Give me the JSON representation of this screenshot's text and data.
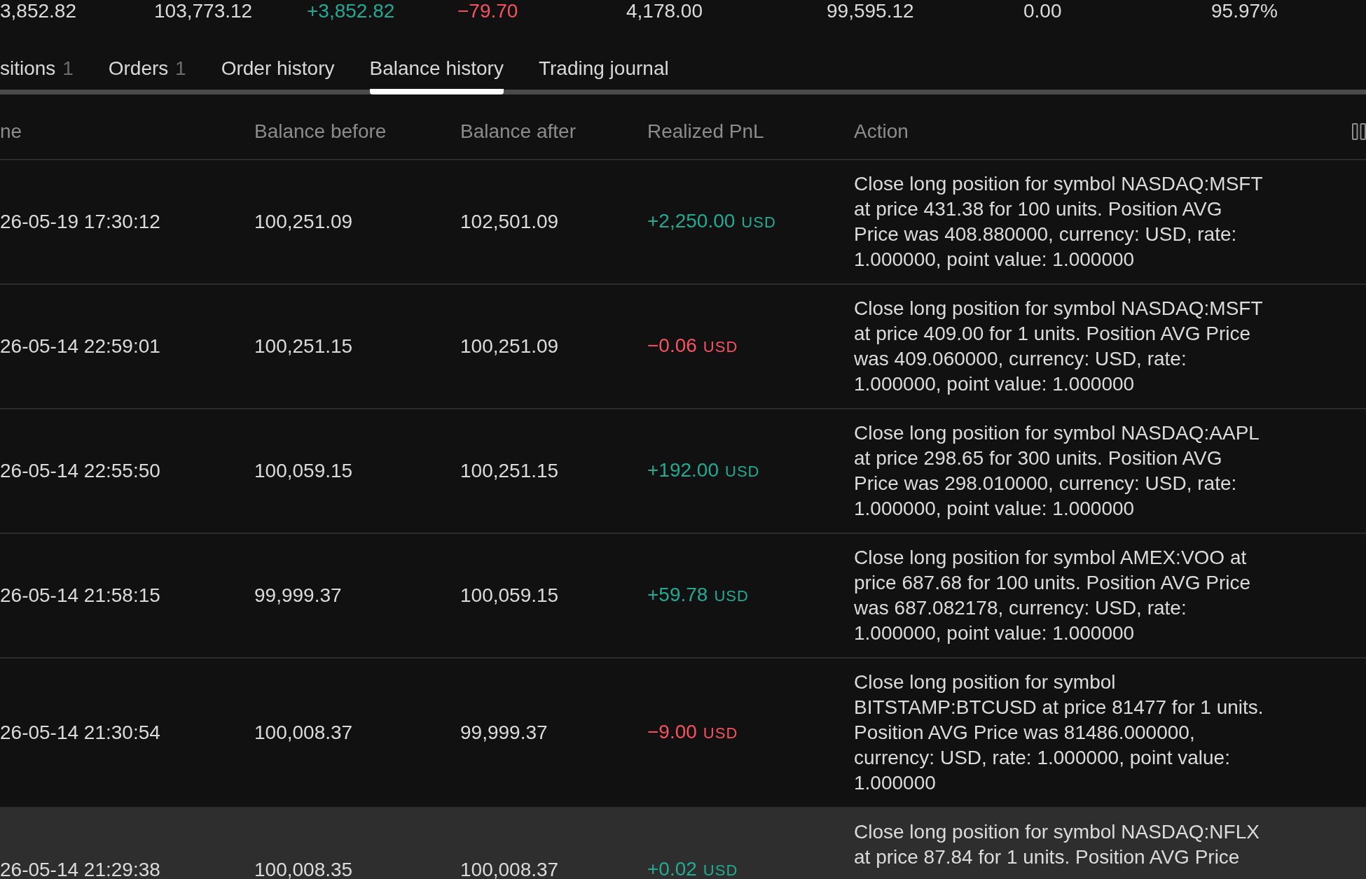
{
  "summary": [
    {
      "value": "3,852.82",
      "color": "#dbdbdb"
    },
    {
      "value": "103,773.12",
      "color": "#dbdbdb"
    },
    {
      "value": "+3,852.82",
      "color": "#22ab94"
    },
    {
      "value": "−79.70",
      "color": "#f7525f"
    },
    {
      "value": "4,178.00",
      "color": "#dbdbdb"
    },
    {
      "value": "99,595.12",
      "color": "#dbdbdb"
    },
    {
      "value": "0.00",
      "color": "#dbdbdb"
    },
    {
      "value": "95.97%",
      "color": "#dbdbdb"
    }
  ],
  "tabs": [
    {
      "label": "sitions",
      "count": "1",
      "selected": false
    },
    {
      "label": "Orders",
      "count": "1",
      "selected": false
    },
    {
      "label": "Order history",
      "selected": false
    },
    {
      "label": "Balance history",
      "selected": true
    },
    {
      "label": "Trading journal",
      "selected": false
    }
  ],
  "table": {
    "columns": [
      "ne",
      "Balance before",
      "Balance after",
      "Realized PnL",
      "Action"
    ],
    "rows": [
      {
        "time": "26-05-19 17:30:12",
        "balance_before": "100,251.09",
        "balance_after": "102,501.09",
        "realized_pnl": {
          "value": "+2,250.00",
          "currency": "USD",
          "color": "#22ab94"
        },
        "action": "Close long position for symbol NASDAQ:MSFT at price 431.38 for 100 units. Position AVG Price was 408.880000, currency: USD, rate: 1.000000, point value: 1.000000",
        "highlighted": false
      },
      {
        "time": "26-05-14 22:59:01",
        "balance_before": "100,251.15",
        "balance_after": "100,251.09",
        "realized_pnl": {
          "value": "−0.06",
          "currency": "USD",
          "color": "#f7525f"
        },
        "action": "Close long position for symbol NASDAQ:MSFT at price 409.00 for 1 units. Position AVG Price was 409.060000, currency: USD, rate: 1.000000, point value: 1.000000",
        "highlighted": false
      },
      {
        "time": "26-05-14 22:55:50",
        "balance_before": "100,059.15",
        "balance_after": "100,251.15",
        "realized_pnl": {
          "value": "+192.00",
          "currency": "USD",
          "color": "#22ab94"
        },
        "action": "Close long position for symbol NASDAQ:AAPL at price 298.65 for 300 units. Position AVG Price was 298.010000, currency: USD, rate: 1.000000, point value: 1.000000",
        "highlighted": false
      },
      {
        "time": "26-05-14 21:58:15",
        "balance_before": "99,999.37",
        "balance_after": "100,059.15",
        "realized_pnl": {
          "value": "+59.78",
          "currency": "USD",
          "color": "#22ab94"
        },
        "action": "Close long position for symbol AMEX:VOO at price 687.68 for 100 units. Position AVG Price was 687.082178, currency: USD, rate: 1.000000, point value: 1.000000",
        "highlighted": false
      },
      {
        "time": "26-05-14 21:30:54",
        "balance_before": "100,008.37",
        "balance_after": "99,999.37",
        "realized_pnl": {
          "value": "−9.00",
          "currency": "USD",
          "color": "#f7525f"
        },
        "action": "Close long position for symbol BITSTAMP:BTCUSD at price 81477 for 1 units. Position AVG Price was 81486.000000, currency: USD, rate: 1.000000, point value: 1.000000",
        "highlighted": false
      },
      {
        "time": "26-05-14 21:29:38",
        "balance_before": "100,008.35",
        "balance_after": "100,008.37",
        "realized_pnl": {
          "value": "+0.02",
          "currency": "USD",
          "color": "#22ab94"
        },
        "action": "Close long position for symbol NASDAQ:NFLX at price 87.84 for 1 units. Position AVG Price",
        "highlighted": true
      }
    ]
  }
}
